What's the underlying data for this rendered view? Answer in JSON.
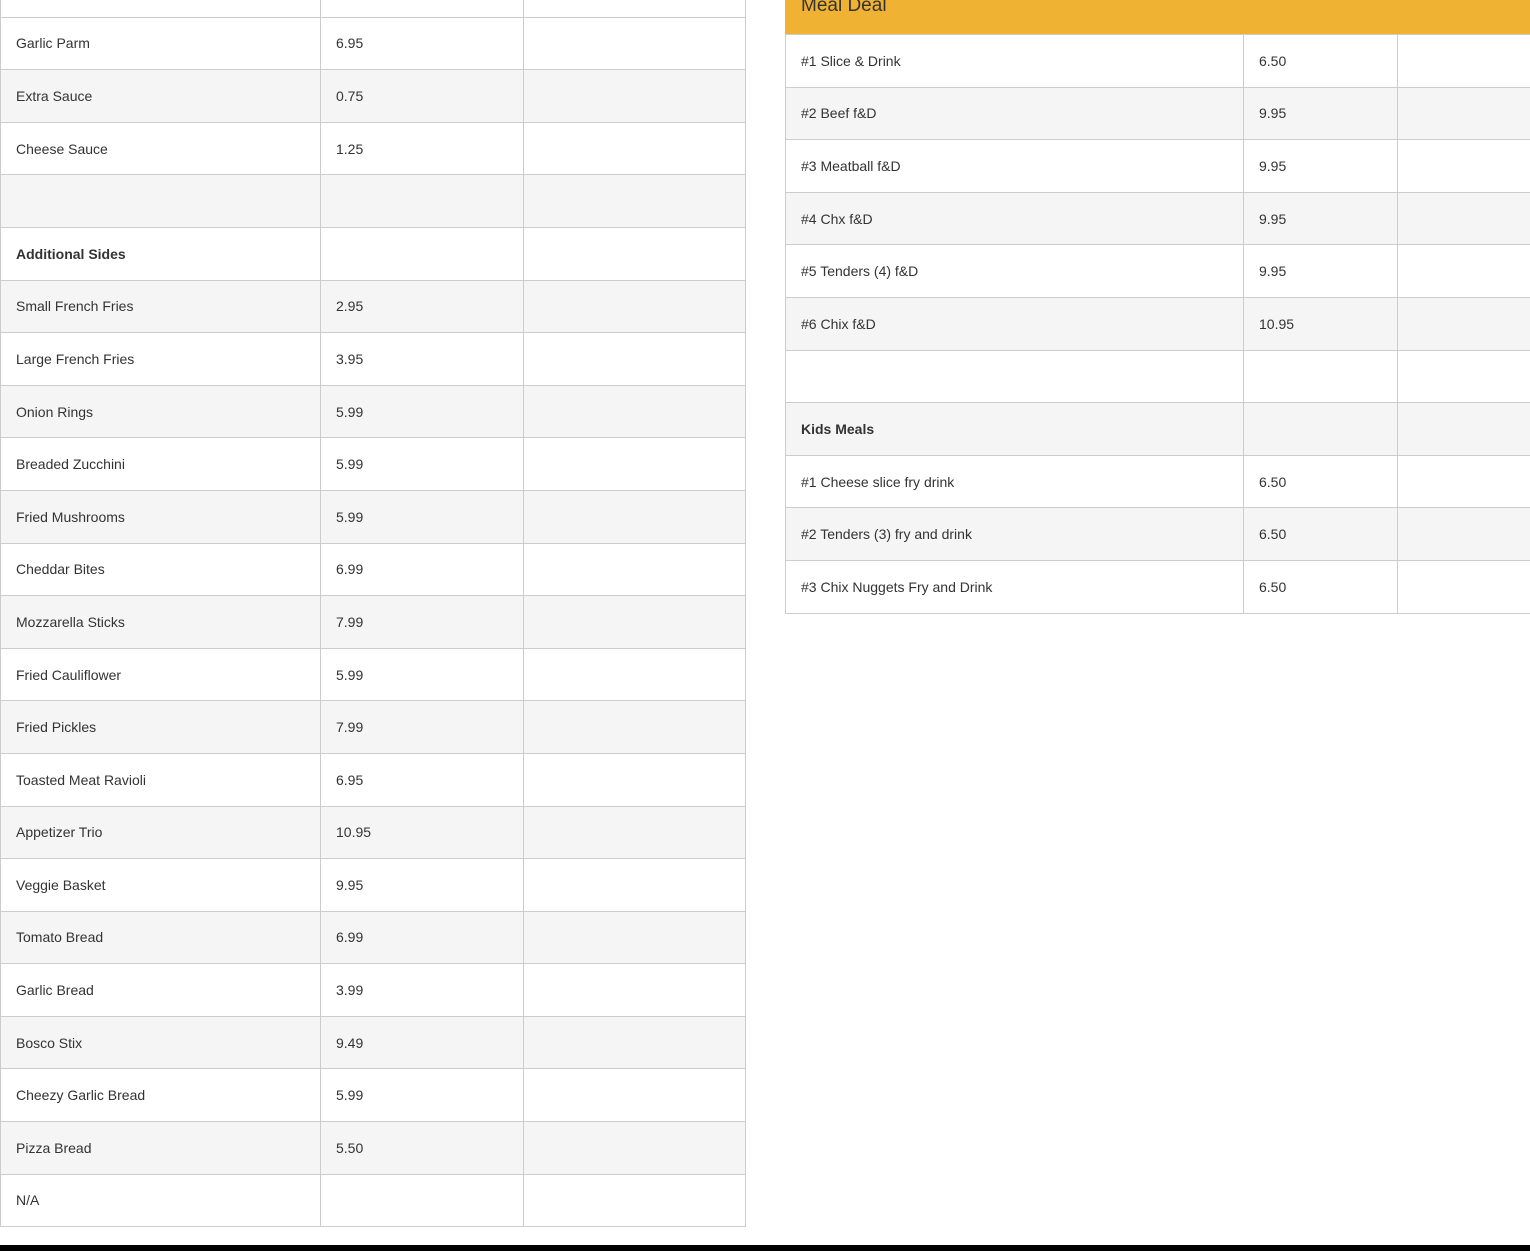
{
  "left_table": {
    "rows": [
      {
        "item": "",
        "price": "",
        "extra": "",
        "kind": "odd"
      },
      {
        "item": "Garlic Parm",
        "price": "6.95",
        "extra": "",
        "kind": "odd"
      },
      {
        "item": "Extra Sauce",
        "price": "0.75",
        "extra": "",
        "kind": "even"
      },
      {
        "item": "Cheese Sauce",
        "price": "1.25",
        "extra": "",
        "kind": "odd"
      },
      {
        "item": "",
        "price": "",
        "extra": "",
        "kind": "even"
      },
      {
        "item": "Additional Sides",
        "price": "",
        "extra": "",
        "kind": "odd",
        "section": true
      },
      {
        "item": "Small French Fries",
        "price": "2.95",
        "extra": "",
        "kind": "even"
      },
      {
        "item": "Large French Fries",
        "price": "3.95",
        "extra": "",
        "kind": "odd"
      },
      {
        "item": "Onion Rings",
        "price": "5.99",
        "extra": "",
        "kind": "even"
      },
      {
        "item": "Breaded Zucchini",
        "price": "5.99",
        "extra": "",
        "kind": "odd"
      },
      {
        "item": "Fried Mushrooms",
        "price": "5.99",
        "extra": "",
        "kind": "even"
      },
      {
        "item": "Cheddar Bites",
        "price": "6.99",
        "extra": "",
        "kind": "odd"
      },
      {
        "item": "Mozzarella Sticks",
        "price": "7.99",
        "extra": "",
        "kind": "even"
      },
      {
        "item": "Fried Cauliflower",
        "price": "5.99",
        "extra": "",
        "kind": "odd"
      },
      {
        "item": "Fried Pickles",
        "price": "7.99",
        "extra": "",
        "kind": "even"
      },
      {
        "item": "Toasted Meat Ravioli",
        "price": "6.95",
        "extra": "",
        "kind": "odd"
      },
      {
        "item": "Appetizer Trio",
        "price": "10.95",
        "extra": "",
        "kind": "even"
      },
      {
        "item": "Veggie Basket",
        "price": "9.95",
        "extra": "",
        "kind": "odd"
      },
      {
        "item": "Tomato Bread",
        "price": "6.99",
        "extra": "",
        "kind": "even"
      },
      {
        "item": "Garlic Bread",
        "price": "3.99",
        "extra": "",
        "kind": "odd"
      },
      {
        "item": "Bosco Stix",
        "price": "9.49",
        "extra": "",
        "kind": "even"
      },
      {
        "item": "Cheezy Garlic Bread",
        "price": "5.99",
        "extra": "",
        "kind": "odd"
      },
      {
        "item": "Pizza Bread",
        "price": "5.50",
        "extra": "",
        "kind": "even"
      },
      {
        "item": "N/A",
        "price": "",
        "extra": "",
        "kind": "odd"
      }
    ]
  },
  "right_table": {
    "header": "Meal Deal",
    "header_color": "#f0b232",
    "rows": [
      {
        "item": "#1 Slice & Drink",
        "price": "6.50",
        "extra": "",
        "kind": "odd"
      },
      {
        "item": "#2 Beef f&D",
        "price": "9.95",
        "extra": "",
        "kind": "even"
      },
      {
        "item": "#3 Meatball f&D",
        "price": "9.95",
        "extra": "",
        "kind": "odd"
      },
      {
        "item": "#4 Chx f&D",
        "price": "9.95",
        "extra": "",
        "kind": "even"
      },
      {
        "item": "#5 Tenders (4) f&D",
        "price": "9.95",
        "extra": "",
        "kind": "odd"
      },
      {
        "item": "#6 Chix f&D",
        "price": "10.95",
        "extra": "",
        "kind": "even"
      },
      {
        "item": "",
        "price": "",
        "extra": "",
        "kind": "odd"
      },
      {
        "item": "Kids Meals",
        "price": "",
        "extra": "",
        "kind": "even",
        "section": true
      },
      {
        "item": "#1 Cheese slice fry drink",
        "price": "6.50",
        "extra": "",
        "kind": "odd"
      },
      {
        "item": "#2 Tenders (3) fry and drink",
        "price": "6.50",
        "extra": "",
        "kind": "even"
      },
      {
        "item": "#3 Chix Nuggets Fry and Drink",
        "price": "6.50",
        "extra": "",
        "kind": "odd"
      }
    ]
  }
}
